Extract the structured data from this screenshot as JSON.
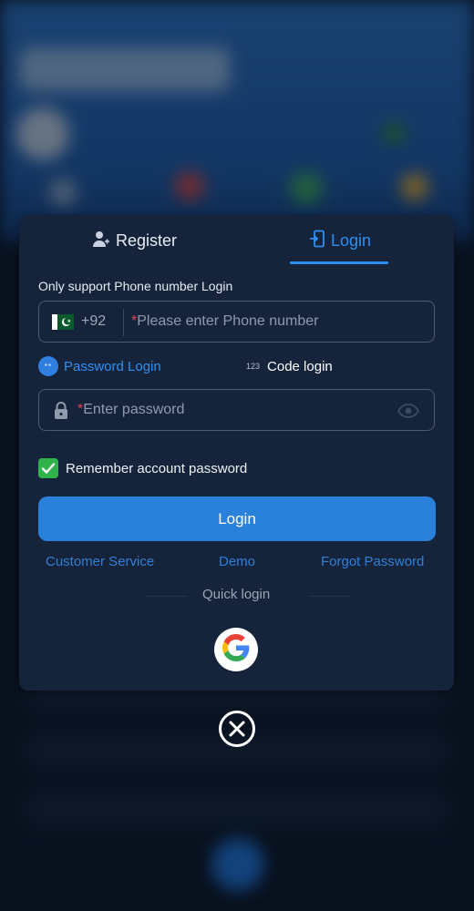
{
  "tabs": {
    "register_label": "Register",
    "login_label": "Login",
    "active": "Login"
  },
  "form": {
    "note": "Only support Phone number Login",
    "country_code": "+92",
    "phone_required_mark": "*",
    "phone_placeholder": "Please enter Phone number",
    "mode_password_label": "Password Login",
    "mode_password_badge": "**",
    "mode_code_label": "Code login",
    "mode_code_badge": "123",
    "password_required_mark": "*",
    "password_placeholder": "Enter password",
    "remember_label": "Remember account password",
    "remember_checked": true,
    "login_button": "Login"
  },
  "links": {
    "customer_service": "Customer Service",
    "demo": "Demo",
    "forgot_password": "Forgot Password"
  },
  "quick_login": {
    "label": "Quick login",
    "providers": [
      "google-icon"
    ]
  },
  "colors": {
    "accent": "#2f8ff0",
    "modal_bg": "#15243b",
    "button": "#2a81db",
    "checkbox": "#2fb34a",
    "required": "#e0454e"
  }
}
